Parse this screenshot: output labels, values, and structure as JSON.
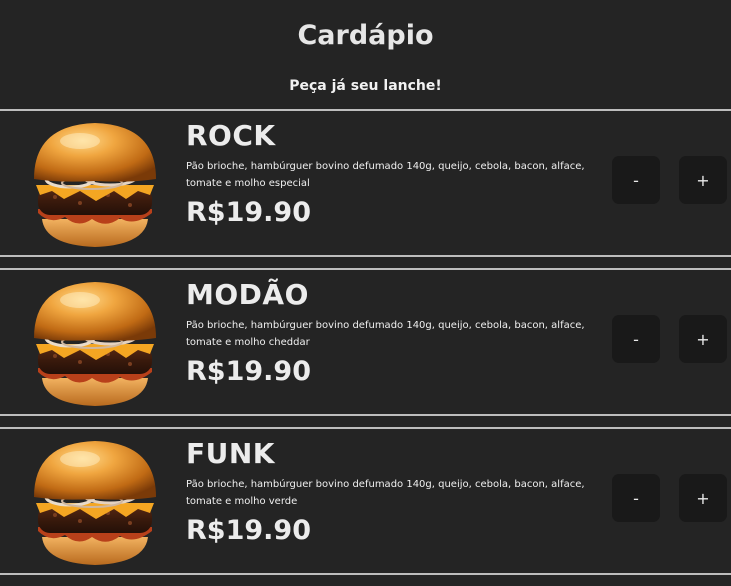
{
  "header": {
    "title": "Cardápio",
    "subtitle": "Peça já seu lanche!"
  },
  "items": [
    {
      "name": "ROCK",
      "description": "Pão brioche, hambúrguer bovino defumado 140g, queijo, cebola, bacon, alface, tomate e molho especial",
      "price": "R$19.90",
      "minus_label": "-",
      "plus_label": "+"
    },
    {
      "name": "MODÃO",
      "description": "Pão brioche, hambúrguer bovino defumado 140g, queijo, cebola, bacon, alface, tomate e molho cheddar",
      "price": "R$19.90",
      "minus_label": "-",
      "plus_label": "+"
    },
    {
      "name": "FUNK",
      "description": "Pão brioche, hambúrguer bovino defumado 140g, queijo, cebola, bacon, alface, tomate e molho verde",
      "price": "R$19.90",
      "minus_label": "-",
      "plus_label": "+"
    }
  ],
  "colors": {
    "background": "#242424",
    "button": "#191919",
    "divider": "#bdbdbd",
    "text": "#ececec"
  }
}
